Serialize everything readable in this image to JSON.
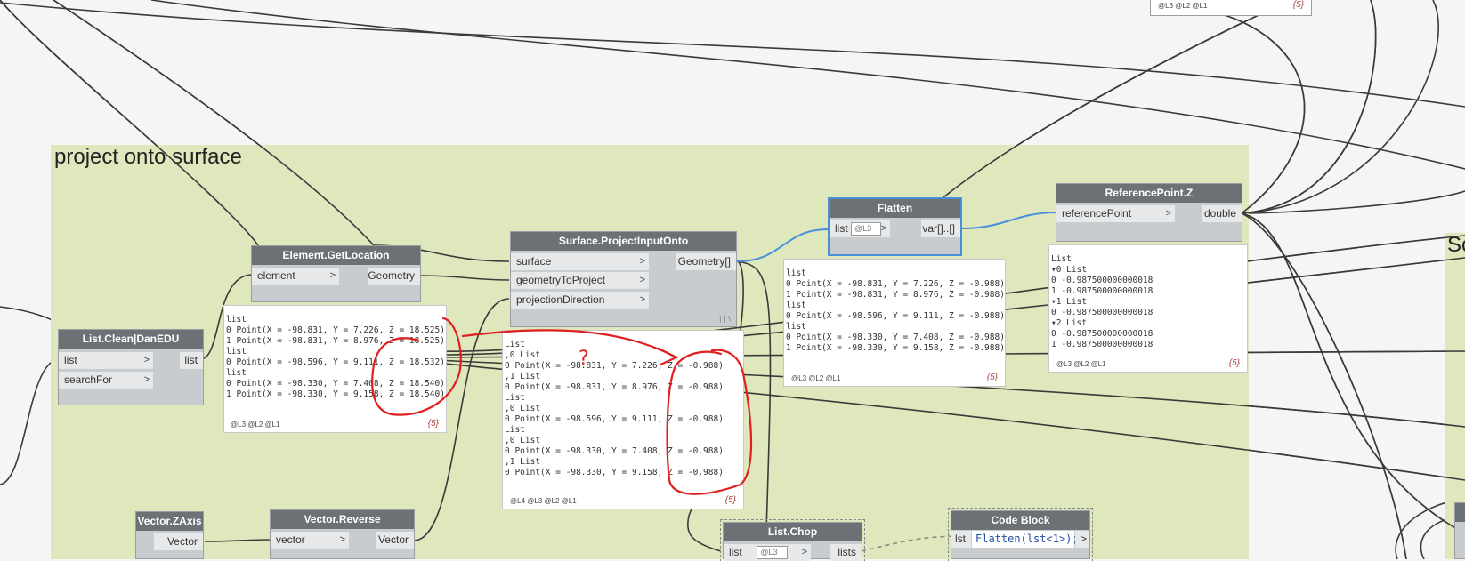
{
  "group": {
    "title": "project onto surface",
    "second_group_title": "Sc"
  },
  "nodes": {
    "list_clean": {
      "title": "List.Clean|DanEDU",
      "in1": "list",
      "in2": "searchFor",
      "out1": "list"
    },
    "element_getlocation": {
      "title": "Element.GetLocation",
      "in1": "element",
      "out1": "Geometry"
    },
    "surface_project": {
      "title": "Surface.ProjectInputOnto",
      "in1": "surface",
      "in2": "geometryToProject",
      "in3": "projectionDirection",
      "out1": "Geometry[]",
      "lacing": "| | \\"
    },
    "flatten": {
      "title": "Flatten",
      "in1": "list",
      "level": "@L3",
      "out1": "var[]..[]"
    },
    "refpoint_z": {
      "title": "ReferencePoint.Z",
      "in1": "referencePoint",
      "out1": "double"
    },
    "vector_zaxis": {
      "title": "Vector.ZAxis",
      "out1": "Vector"
    },
    "vector_reverse": {
      "title": "Vector.Reverse",
      "in1": "vector",
      "out1": "Vector"
    },
    "list_chop": {
      "title": "List.Chop",
      "in1": "list",
      "level": "@L3",
      "out1": "lists"
    },
    "code_block": {
      "title": "Code Block",
      "in1": "lst",
      "code": "Flatten(lst<1>);",
      "out1": ">"
    },
    "top_right_footer": "@L3 @L2 @L1",
    "top_right_count": "{5}"
  },
  "previews": {
    "getlocation": {
      "lines": [
        "list",
        "0  Point(X = -98.831, Y = 7.226, Z = 18.525)",
        "1  Point(X = -98.831, Y = 8.976, Z = 18.525)",
        "list",
        "0  Point(X = -98.596, Y = 9.111, Z = 18.532)",
        "list",
        "0  Point(X = -98.330, Y = 7.408, Z = 18.540)",
        "1  Point(X = -98.330, Y = 9.158, Z = 18.540)"
      ],
      "footer": "@L3 @L2 @L1",
      "count": "{5}"
    },
    "project": {
      "lines": [
        "List",
        ",0 List",
        "    0  Point(X = -98.831, Y = 7.226, Z = -0.988)",
        ",1 List",
        "    0  Point(X = -98.831, Y = 8.976, Z = -0.988)",
        "List",
        ",0 List",
        "    0  Point(X = -98.596, Y = 9.111, Z = -0.988)",
        "List",
        ",0 List",
        "    0  Point(X = -98.330, Y = 7.408, Z = -0.988)",
        ",1 List",
        "    0  Point(X = -98.330, Y = 9.158, Z = -0.988)"
      ],
      "footer": "@L4 @L3 @L2 @L1",
      "count": "{5}"
    },
    "flatten": {
      "lines": [
        "list",
        "0  Point(X = -98.831, Y = 7.226, Z = -0.988)",
        "1  Point(X = -98.831, Y = 8.976, Z = -0.988)",
        "list",
        "0  Point(X = -98.596, Y = 9.111, Z = -0.988)",
        "list",
        "0  Point(X = -98.330, Y = 7.408, Z = -0.988)",
        "1  Point(X = -98.330, Y = 9.158, Z = -0.988)"
      ],
      "footer": "@L3 @L2 @L1",
      "count": "{5}"
    },
    "refz": {
      "lines": [
        "List",
        "  ▾0 List",
        "      0  -0.987500000000018",
        "      1  -0.987500000000018",
        "  ▾1 List",
        "      0  -0.987500000000018",
        "  ▾2 List",
        "      0  -0.987500000000018",
        "      1  -0.987500000000018"
      ],
      "footer": "@L3 @L2 @L1",
      "count": "{5}"
    }
  },
  "annotation": {
    "question_mark": "?",
    "ink_color": "#e02020"
  },
  "colors": {
    "group_bg": "#dfe7bd",
    "wire": "#3a3a3a",
    "wire_selected": "#4a90d9",
    "node_title": "#6b7175"
  }
}
